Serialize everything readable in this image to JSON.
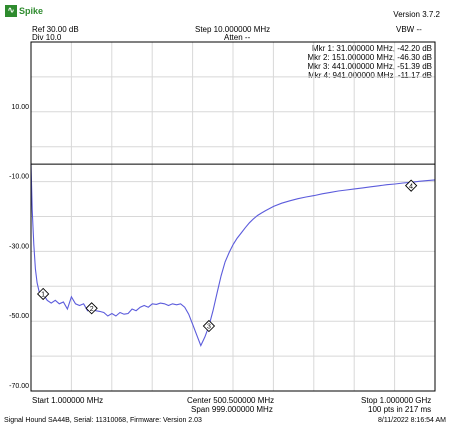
{
  "app": {
    "logo_text": "Spike",
    "version": "Version 3.7.2"
  },
  "header": {
    "ref": "Ref 30.00 dB",
    "div": "Div 10.0",
    "step": "Step 10.000000 MHz",
    "atten": "Atten --",
    "vbw": "VBW --"
  },
  "markers": {
    "mkr1": "Mkr 1: 31.000000 MHz, -42.20 dB",
    "mkr2": "Mkr 2: 151.000000 MHz, -46.30 dB",
    "mkr3": "Mkr 3: 441.000000 MHz, -51.39 dB",
    "mkr4": "Mkr 4: 941.000000 MHz, -11.17 dB"
  },
  "footer": {
    "start": "Start 1.000000 MHz",
    "center": "Center 500.500000 MHz",
    "span": "Span 999.000000 MHz",
    "stop": "Stop 1.000000 GHz",
    "pts": "100 pts in 217 ms",
    "device": "Signal Hound SA44B, Serial: 11310068, Firmware: Version 2.03",
    "datetime": "8/11/2022 8:16:54 AM"
  },
  "colors": {
    "trace": "#5c5cdc",
    "grid": "#d8d8d8",
    "border": "#000000",
    "logo": "#2e8b2e"
  },
  "chart_data": {
    "type": "line",
    "xlim": [
      1,
      1000
    ],
    "ylim": [
      -70,
      30
    ],
    "y_ticks": [
      10,
      -10,
      -30,
      -50,
      -70
    ],
    "y_tick_labels": [
      "10.00",
      "-10.00",
      "-30.00",
      "-50.00",
      "-70.00"
    ],
    "reference_line": -5,
    "grid": true,
    "series": [
      {
        "x": [
          1,
          4,
          8,
          12,
          16,
          21,
          26,
          31,
          41,
          51,
          61,
          71,
          81,
          91,
          101,
          111,
          121,
          131,
          141,
          151,
          161,
          171,
          181,
          191,
          201,
          211,
          221,
          231,
          241,
          251,
          261,
          271,
          281,
          291,
          301,
          311,
          321,
          331,
          341,
          351,
          361,
          371,
          381,
          391,
          401,
          411,
          421,
          431,
          441,
          451,
          461,
          471,
          481,
          491,
          501,
          511,
          521,
          531,
          541,
          551,
          561,
          571,
          581,
          591,
          601,
          621,
          641,
          661,
          681,
          701,
          721,
          741,
          761,
          781,
          801,
          821,
          841,
          861,
          881,
          901,
          921,
          941,
          961,
          981,
          1000
        ],
        "y": [
          -5,
          -18,
          -28,
          -35,
          -39,
          -41.5,
          -42,
          -42.2,
          -44,
          -44.8,
          -44,
          -45,
          -44.5,
          -46.5,
          -43,
          -45,
          -45.5,
          -45,
          -47,
          -46.3,
          -47,
          -47.2,
          -47.5,
          -48.5,
          -47.8,
          -48.5,
          -47.5,
          -48,
          -47.8,
          -46.5,
          -47,
          -46,
          -45.5,
          -46,
          -45,
          -45.2,
          -44.8,
          -45,
          -45.5,
          -45,
          -45.3,
          -45,
          -46,
          -48,
          -51,
          -54,
          -57,
          -54.5,
          -51.4,
          -47,
          -42,
          -37,
          -33,
          -30.3,
          -28,
          -26.2,
          -24.7,
          -23.2,
          -21.8,
          -20.7,
          -19.7,
          -19,
          -18.3,
          -17.7,
          -17.1,
          -16.2,
          -15.5,
          -14.9,
          -14.4,
          -14,
          -13.5,
          -13.1,
          -12.7,
          -12.4,
          -12.1,
          -11.8,
          -11.5,
          -11.2,
          -10.9,
          -10.7,
          -10.4,
          -10.2,
          -9.9,
          -9.7,
          -9.5
        ]
      }
    ],
    "markers": [
      {
        "label": "1",
        "x": 31,
        "y": -42.2
      },
      {
        "label": "2",
        "x": 151,
        "y": -46.3
      },
      {
        "label": "3",
        "x": 441,
        "y": -51.39
      },
      {
        "label": "4",
        "x": 941,
        "y": -11.17
      }
    ]
  }
}
